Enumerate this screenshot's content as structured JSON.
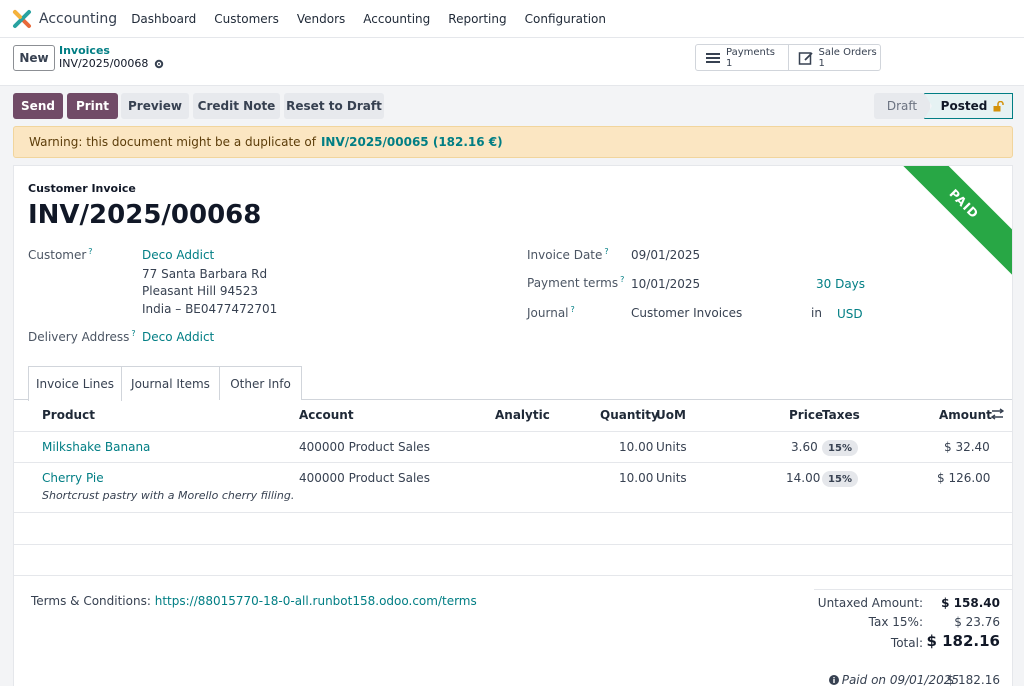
{
  "navbar": {
    "app_name": "Accounting",
    "menu": [
      "Dashboard",
      "Customers",
      "Vendors",
      "Accounting",
      "Reporting",
      "Configuration"
    ]
  },
  "control": {
    "new_label": "New",
    "breadcrumb_parent": "Invoices",
    "breadcrumb_current": "INV/2025/00068",
    "smart_buttons": [
      {
        "label": "Payments",
        "count": "1",
        "icon": "list-icon"
      },
      {
        "label": "Sale Orders",
        "count": "1",
        "icon": "edit-icon"
      }
    ]
  },
  "actions": {
    "send": "Send",
    "print": "Print",
    "preview": "Preview",
    "credit_note": "Credit Note",
    "reset_to_draft": "Reset to Draft",
    "stages": [
      "Draft",
      "Posted"
    ],
    "active_stage": "Posted"
  },
  "alert": {
    "text": "Warning: this document might be a duplicate of",
    "link": "INV/2025/00065 (182.16 €)"
  },
  "invoice": {
    "ribbon": "PAID",
    "type": "Customer Invoice",
    "number": "INV/2025/00068",
    "customer_label": "Customer",
    "customer": "Deco Addict",
    "address_line1": "77 Santa Barbara Rd",
    "address_line2": "Pleasant Hill 94523",
    "address_line3": "India – BE0477472701",
    "delivery_label": "Delivery Address",
    "delivery": "Deco Addict",
    "invoice_date_label": "Invoice Date",
    "invoice_date": "09/01/2025",
    "payment_terms_label": "Payment terms",
    "payment_terms_date": "10/01/2025",
    "payment_terms": "30 Days",
    "journal_label": "Journal",
    "journal": "Customer Invoices",
    "in_label": "in",
    "currency": "USD"
  },
  "tabs": [
    "Invoice Lines",
    "Journal Items",
    "Other Info"
  ],
  "table": {
    "headers": [
      "Product",
      "Account",
      "Analytic",
      "Quantity",
      "UoM",
      "Price",
      "Taxes",
      "Amount"
    ],
    "rows": [
      {
        "product": "Milkshake Banana",
        "description": "",
        "account": "400000 Product Sales",
        "quantity": "10.00",
        "uom": "Units",
        "price": "3.60",
        "tax": "15%",
        "amount": "$ 32.40"
      },
      {
        "product": "Cherry Pie",
        "description": "Shortcrust pastry with a Morello cherry filling.",
        "account": "400000 Product Sales",
        "quantity": "10.00",
        "uom": "Units",
        "price": "14.00",
        "tax": "15%",
        "amount": "$ 126.00"
      }
    ]
  },
  "footer": {
    "terms_label": "Terms & Conditions:",
    "terms_link": "https://88015770-18-0-all.runbot158.odoo.com/terms",
    "untaxed_label": "Untaxed Amount:",
    "untaxed": "$ 158.40",
    "tax_label": "Tax 15%:",
    "tax": "$ 23.76",
    "total_label": "Total:",
    "total": "$ 182.16",
    "paid_label": "Paid on 09/01/2025",
    "paid": "$ 182.16"
  },
  "colors": {
    "primary": "#714b67",
    "link": "#017e84",
    "ribbon": "#28a745",
    "alert_bg": "#fbe6c2"
  }
}
